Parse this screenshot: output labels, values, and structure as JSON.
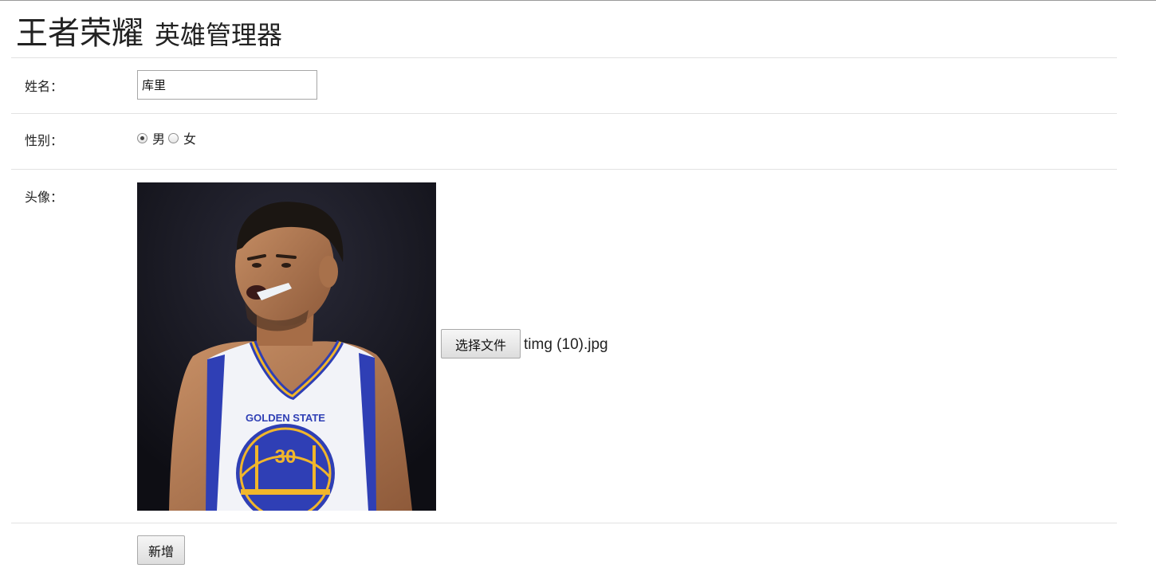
{
  "header": {
    "title_main": "王者荣耀",
    "title_sub": "英雄管理器"
  },
  "form": {
    "name_label": "姓名：",
    "name_value": "库里",
    "gender_label": "性别：",
    "gender_options": [
      {
        "label": "男",
        "checked": true
      },
      {
        "label": "女",
        "checked": false
      }
    ],
    "avatar_label": "头像：",
    "avatar_icon": "basketball-player-photo",
    "avatar_jersey_text": "GOLDEN STATE",
    "avatar_jersey_number": "30",
    "file_button_label": "选择文件",
    "file_name": "timg (10).jpg",
    "submit_label": "新增"
  },
  "colors": {
    "jersey_white": "#f2f3f8",
    "jersey_blue": "#2f3fb5",
    "jersey_gold": "#f1b62b",
    "skin": "#b67a52",
    "background_dark": "#14141c"
  }
}
